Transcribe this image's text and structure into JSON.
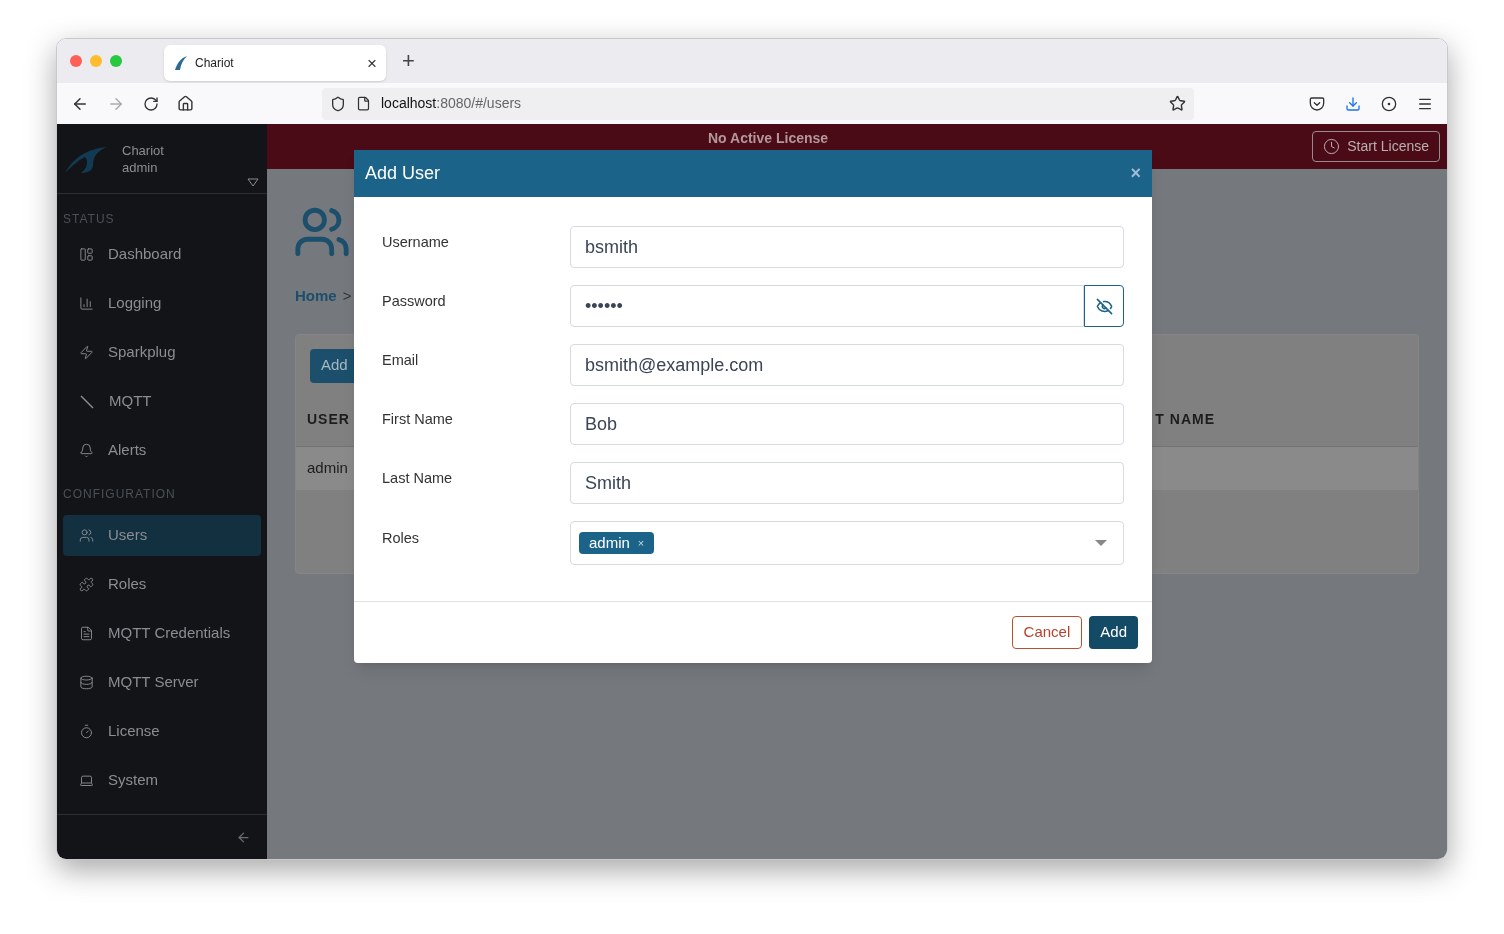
{
  "browser": {
    "tab_title": "Chariot",
    "tab_close": "×",
    "new_tab": "+",
    "url_host": "localhost",
    "url_path": ":8080/#/users"
  },
  "sidebar": {
    "brand": "Chariot",
    "user": "admin",
    "sections": [
      {
        "title": "STATUS",
        "items": [
          {
            "label": "Dashboard",
            "selected": false
          },
          {
            "label": "Logging",
            "selected": false
          },
          {
            "label": "Sparkplug",
            "selected": false
          },
          {
            "label": "MQTT",
            "selected": false
          },
          {
            "label": "Alerts",
            "selected": false
          }
        ]
      },
      {
        "title": "CONFIGURATION",
        "items": [
          {
            "label": "Users",
            "selected": true
          },
          {
            "label": "Roles",
            "selected": false
          },
          {
            "label": "MQTT Credentials",
            "selected": false
          },
          {
            "label": "MQTT Server",
            "selected": false
          },
          {
            "label": "License",
            "selected": false
          },
          {
            "label": "System",
            "selected": false
          }
        ]
      }
    ]
  },
  "banner": {
    "text": "No Active License",
    "button": "Start License"
  },
  "page": {
    "breadcrumb": "Home",
    "breadcrumb_separator": ">",
    "add_button": "Add",
    "table": {
      "columns": [
        "USER",
        "T NAME"
      ],
      "rows": [
        [
          "admin"
        ]
      ]
    }
  },
  "modal": {
    "title": "Add User",
    "close": "×",
    "fields": [
      {
        "label": "Username",
        "kind": "text",
        "value": "bsmith"
      },
      {
        "label": "Password",
        "kind": "password",
        "value": "••••••"
      },
      {
        "label": "Email",
        "kind": "text",
        "value": "bsmith@example.com"
      },
      {
        "label": "First Name",
        "kind": "text",
        "value": "Bob"
      },
      {
        "label": "Last Name",
        "kind": "text",
        "value": "Smith"
      },
      {
        "label": "Roles",
        "kind": "tags",
        "tags": [
          {
            "label": "admin",
            "remove": "×"
          }
        ]
      }
    ],
    "buttons": [
      {
        "label": "Cancel",
        "kind": "secondary"
      },
      {
        "label": "Add",
        "kind": "primary"
      }
    ]
  }
}
